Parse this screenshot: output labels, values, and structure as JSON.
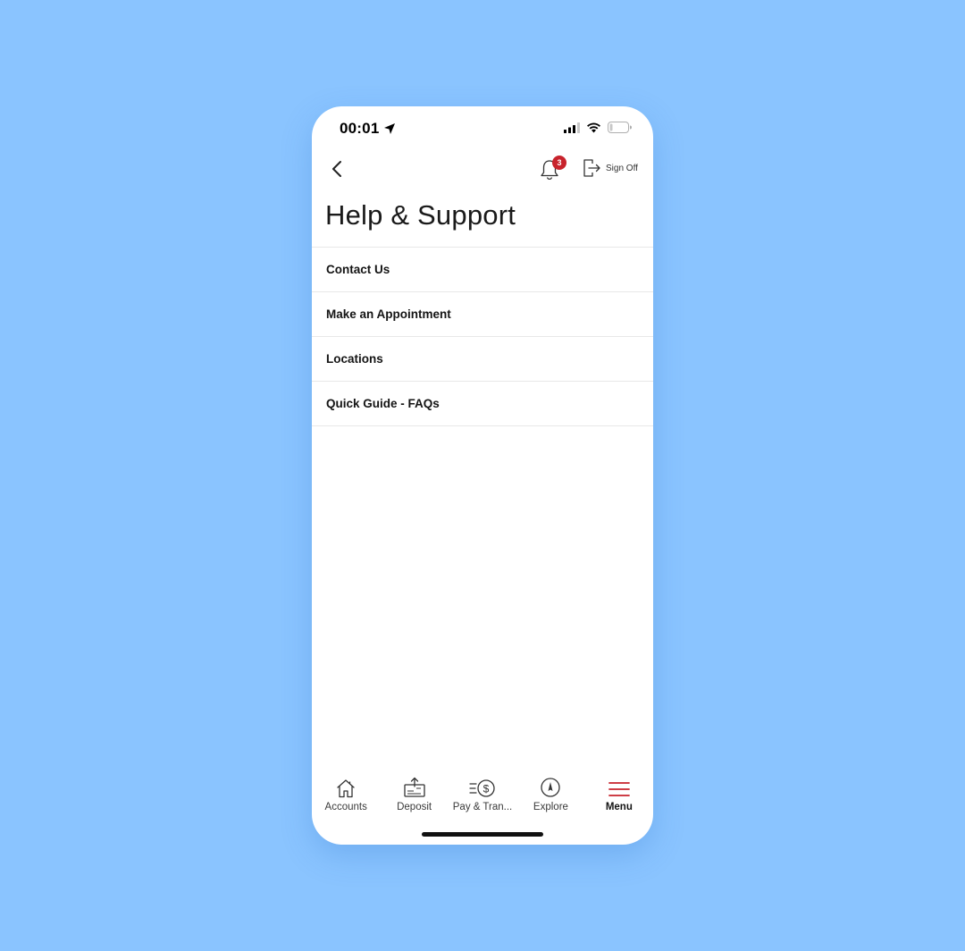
{
  "status_bar": {
    "time": "00:01"
  },
  "header": {
    "notifications_count": "3",
    "sign_off_label": "Sign Off"
  },
  "page": {
    "title": "Help & Support"
  },
  "menu": {
    "items": [
      {
        "label": "Contact Us"
      },
      {
        "label": "Make an Appointment"
      },
      {
        "label": "Locations"
      },
      {
        "label": "Quick Guide - FAQs"
      }
    ]
  },
  "tabbar": {
    "tabs": [
      {
        "label": "Accounts",
        "icon": "home-icon"
      },
      {
        "label": "Deposit",
        "icon": "deposit-check-icon"
      },
      {
        "label": "Pay & Tran...",
        "icon": "pay-transfer-icon"
      },
      {
        "label": "Explore",
        "icon": "compass-icon"
      },
      {
        "label": "Menu",
        "icon": "hamburger-menu-icon",
        "active": true
      }
    ]
  },
  "colors": {
    "background": "#8AC4FF",
    "accent": "#C8232C",
    "text": "#141414"
  }
}
